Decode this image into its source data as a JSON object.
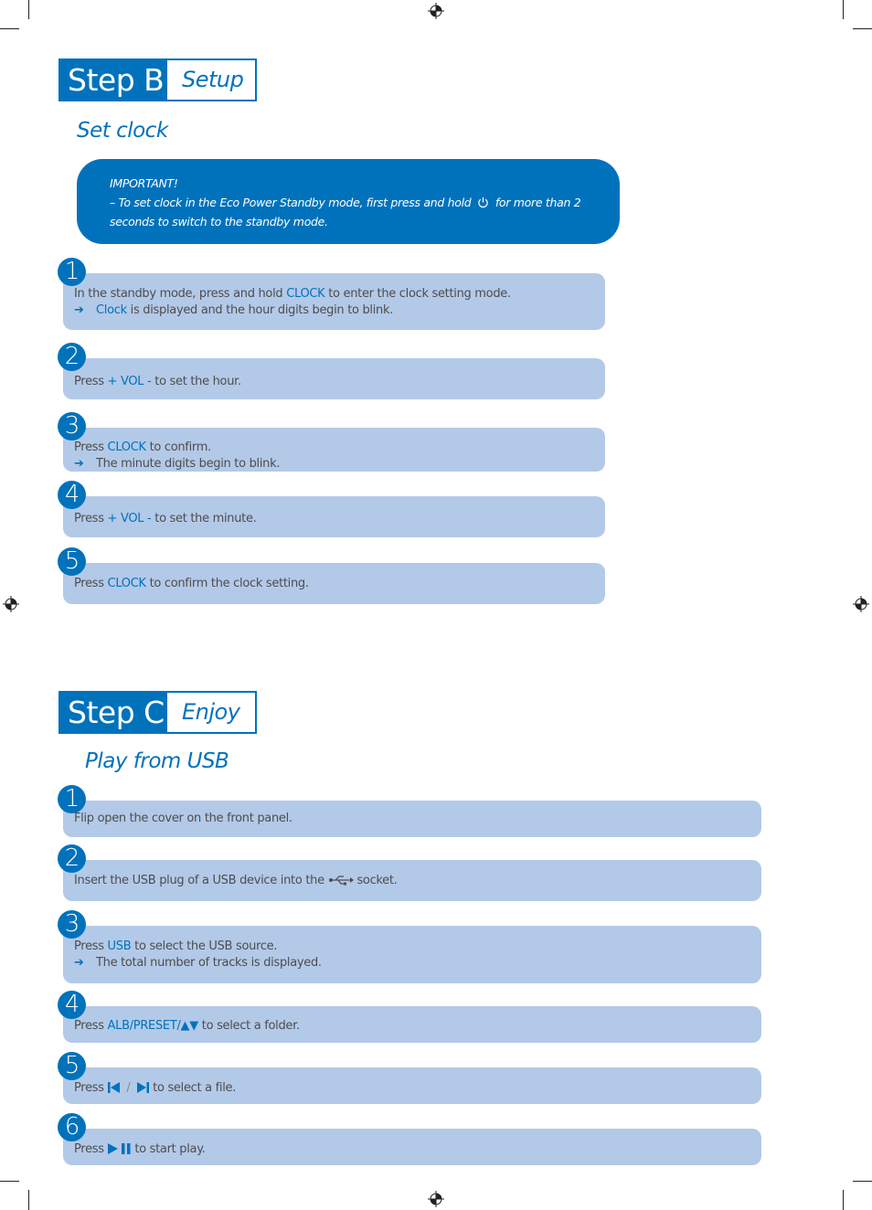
{
  "step_b": {
    "label": "Step B",
    "subtitle": "Setup",
    "section_title": "Set clock",
    "important": {
      "heading": "IMPORTANT!",
      "line1_pre": "– To set clock in the Eco Power Standby mode, first press and hold",
      "line1_icon": "power-icon",
      "line1_post": "for more than 2",
      "line2": "seconds to switch to the standby mode."
    },
    "steps": [
      {
        "number": "1",
        "pre": "In the standby mode, press and hold ",
        "key": "CLOCK",
        "post": " to enter the clock setting mode.",
        "result_arrow": "➔",
        "result_key": "Clock",
        "result_post": " is displayed and the hour digits begin to blink."
      },
      {
        "number": "2",
        "pre": "Press ",
        "key": "+ VOL -",
        "post": " to set the hour."
      },
      {
        "number": "3",
        "pre": "Press ",
        "key": "CLOCK",
        "post": " to confirm.",
        "result_arrow": "➔",
        "result_post": "The minute digits begin to blink."
      },
      {
        "number": "4",
        "pre": "Press ",
        "key": "+ VOL -",
        "post": " to set the minute."
      },
      {
        "number": "5",
        "pre": "Press ",
        "key": "CLOCK",
        "post": " to confirm the clock setting."
      }
    ]
  },
  "step_c": {
    "label": "Step C",
    "subtitle": "Enjoy",
    "section_title": "Play from USB",
    "steps": [
      {
        "number": "1",
        "text": "Flip open the cover on the front panel."
      },
      {
        "number": "2",
        "pre": "Insert the USB plug of a USB device into the ",
        "icon": "usb-icon",
        "post": " socket."
      },
      {
        "number": "3",
        "pre": "Press ",
        "key": "USB",
        "post": " to select the USB source.",
        "result_arrow": "➔",
        "result_post": "The total number of tracks is displayed."
      },
      {
        "number": "4",
        "pre": "Press ",
        "key": "ALB/PRESET/▲▼",
        "post": " to select a folder."
      },
      {
        "number": "5",
        "pre": "Press ",
        "icon_left": "previous-icon",
        "separator": "/",
        "icon_right": "next-icon",
        "post": " to select a file."
      },
      {
        "number": "6",
        "pre": "Press ",
        "icon": "play-pause-icon",
        "post": " to start play."
      }
    ]
  },
  "colors": {
    "brand_blue": "#0072bc",
    "step_bar": "#b3c9e8",
    "body_text": "#4d4d4d"
  }
}
